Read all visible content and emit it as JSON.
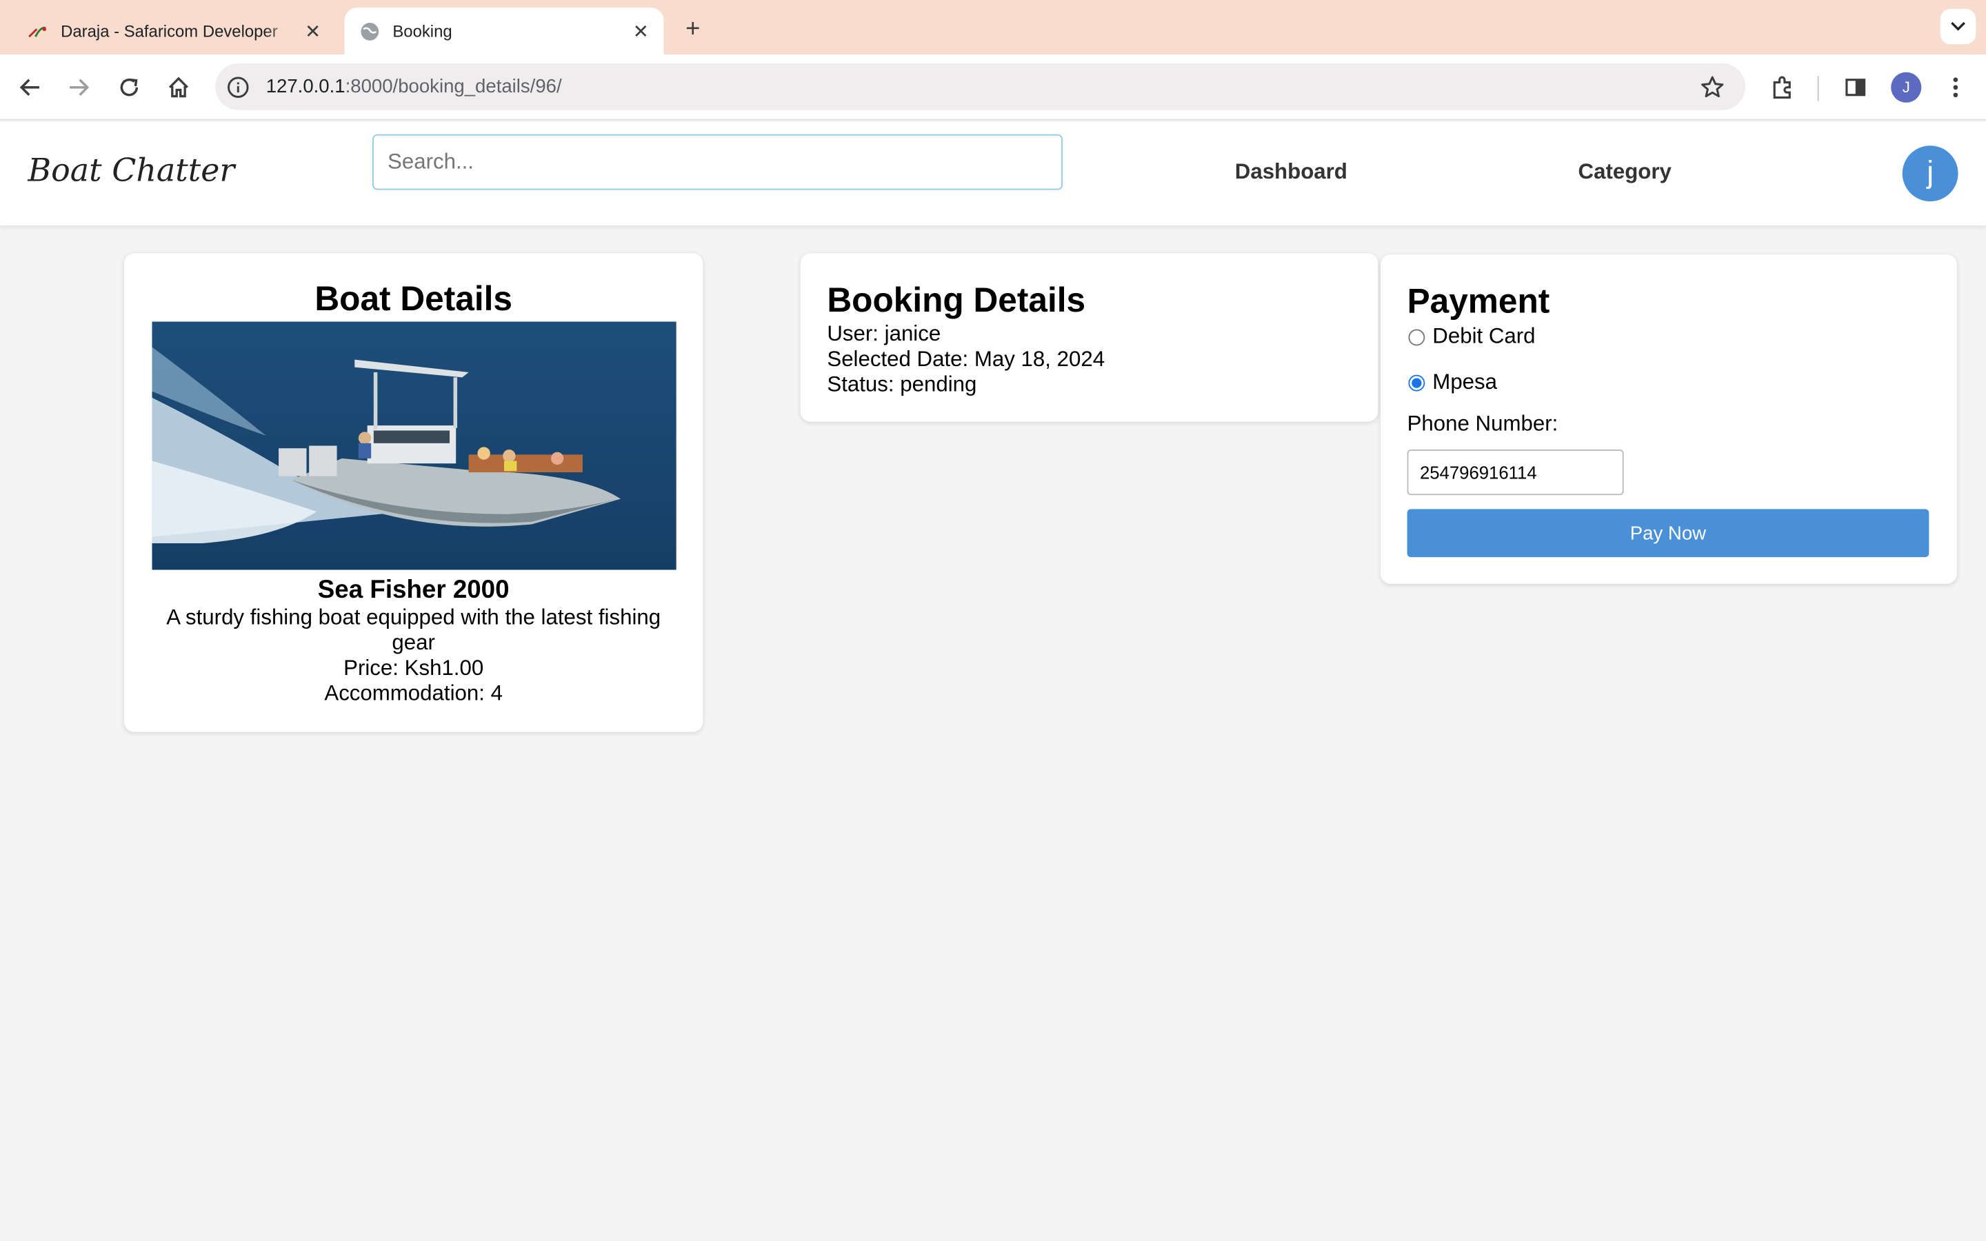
{
  "browser": {
    "tabs": [
      {
        "title": "Daraja - Safaricom Developer",
        "active": false,
        "favicon": "daraja-logo-icon"
      },
      {
        "title": "Booking",
        "active": true,
        "favicon": "globe-icon"
      }
    ],
    "url_host": "127.0.0.1",
    "url_path": ":8000/booking_details/96/",
    "profile_initial": "J"
  },
  "nav": {
    "brand": "Boat Chatter",
    "search_placeholder": "Search...",
    "links": [
      "Dashboard",
      "Category"
    ],
    "avatar_initial": "j",
    "accent": "#4a90d9"
  },
  "boat": {
    "heading": "Boat Details",
    "name": "Sea Fisher 2000",
    "description": "A sturdy fishing boat equipped with the latest fishing gear",
    "price": "Price: Ksh1.00",
    "accommodation": "Accommodation: 4"
  },
  "booking": {
    "heading": "Booking Details",
    "user": "User: janice",
    "date": "Selected Date: May 18, 2024",
    "status": "Status: pending"
  },
  "payment": {
    "heading": "Payment",
    "options": [
      {
        "label": "Debit Card",
        "checked": false
      },
      {
        "label": "Mpesa",
        "checked": true
      }
    ],
    "phone_label": "Phone Number:",
    "phone_value": "254796916114",
    "button": "Pay Now"
  }
}
